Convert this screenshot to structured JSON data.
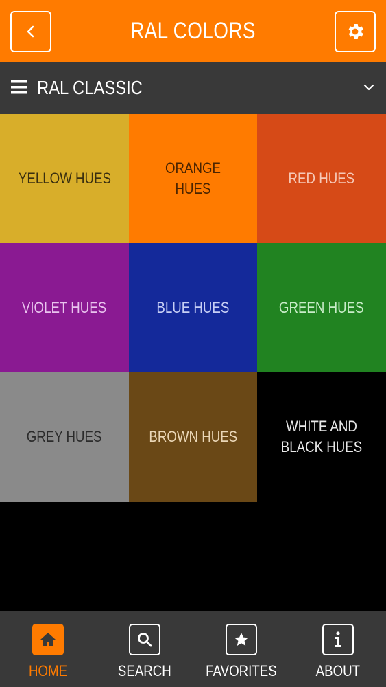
{
  "header": {
    "title": "RAL COLORS",
    "back_icon": "chevron-left-icon",
    "settings_icon": "gear-icon",
    "background": "#ff7b00"
  },
  "subheader": {
    "label": "RAL CLASSIC",
    "menu_icon": "hamburger-menu-icon",
    "dropdown_icon": "chevron-down-icon",
    "background": "#393939"
  },
  "tiles": [
    {
      "label": "YELLOW HUES",
      "bg": "#d8ae2a",
      "fg": "#3a2f10"
    },
    {
      "label": "ORANGE HUES",
      "bg": "#ff7b00",
      "fg": "#4a2400"
    },
    {
      "label": "RED HUES",
      "bg": "#d64a17",
      "fg": "#f6c9b8"
    },
    {
      "label": "VIOLET HUES",
      "bg": "#8a1a92",
      "fg": "#e9c3ee"
    },
    {
      "label": "BLUE HUES",
      "bg": "#14299a",
      "fg": "#c7cff5"
    },
    {
      "label": "GREEN HUES",
      "bg": "#218321",
      "fg": "#c8ecc8"
    },
    {
      "label": "GREY HUES",
      "bg": "#8a8a8a",
      "fg": "#2b2b2b"
    },
    {
      "label": "BROWN HUES",
      "bg": "#6a4816",
      "fg": "#ead6b6"
    },
    {
      "label": "WHITE AND BLACK HUES",
      "bg": "#000000",
      "fg": "#e8e8e8"
    }
  ],
  "bottom_nav": [
    {
      "label": "HOME",
      "icon": "home-icon",
      "active": true
    },
    {
      "label": "SEARCH",
      "icon": "search-icon",
      "active": false
    },
    {
      "label": "FAVORITES",
      "icon": "star-icon",
      "active": false
    },
    {
      "label": "ABOUT",
      "icon": "info-icon",
      "active": false
    }
  ],
  "colors": {
    "accent": "#ff7b00",
    "bar": "#393939",
    "page_background": "#000000"
  }
}
